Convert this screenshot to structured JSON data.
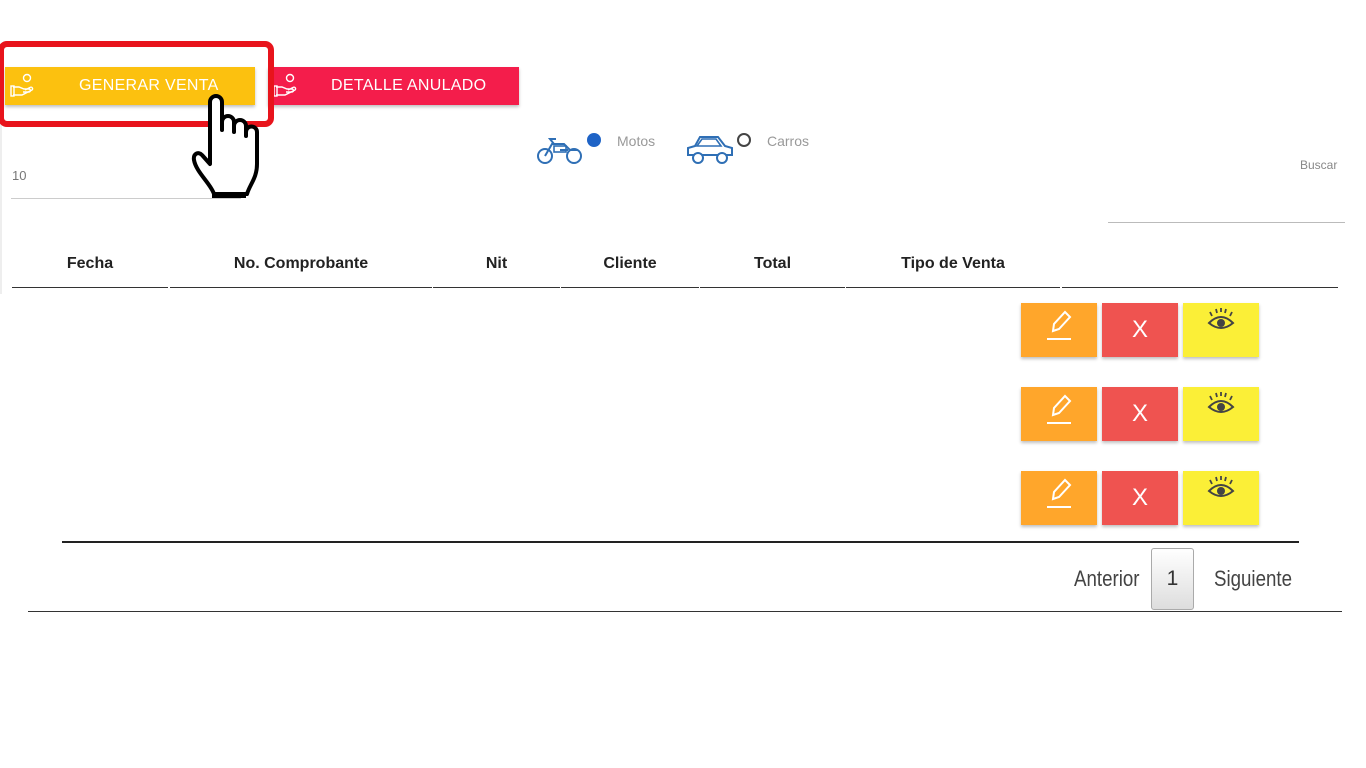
{
  "toolbar": {
    "generate_label": "GENERAR VENTA",
    "detail_label": "DETALLE ANULADO"
  },
  "vehicle_filter": {
    "options": [
      {
        "label": "Motos",
        "icon": "motorcycle-icon",
        "selected": true
      },
      {
        "label": "Carros",
        "icon": "car-icon",
        "selected": false
      }
    ]
  },
  "page_size": "10",
  "search": {
    "label": "Buscar"
  },
  "table": {
    "columns": [
      "Fecha",
      "No. Comprobante",
      "Nit",
      "Cliente",
      "Total",
      "Tipo de Venta"
    ],
    "rows": [
      {
        "actions": [
          "edit",
          "delete",
          "view"
        ],
        "delete_label": "X"
      },
      {
        "actions": [
          "edit",
          "delete",
          "view"
        ],
        "delete_label": "X"
      },
      {
        "actions": [
          "edit",
          "delete",
          "view"
        ],
        "delete_label": "X"
      }
    ]
  },
  "pagination": {
    "prev_label": "Anterior",
    "current_page": "1",
    "next_label": "Siguiente"
  },
  "colors": {
    "generate": "#fcc10f",
    "detail": "#f41d4b",
    "highlight": "#e8141c",
    "edit": "#ffa62b",
    "delete": "#ef5350",
    "view": "#fbef37",
    "radio_selected": "#1e63c6"
  }
}
